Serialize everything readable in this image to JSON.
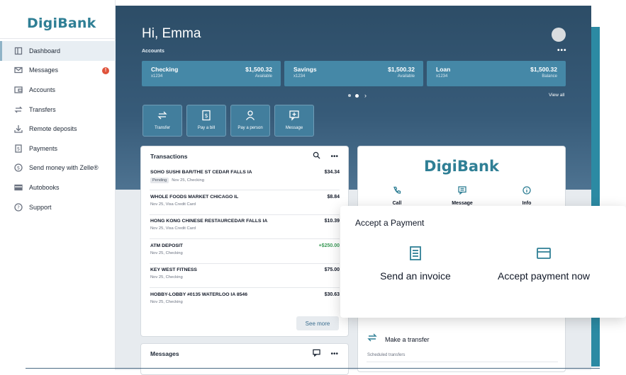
{
  "brand": {
    "name": "DigiBank",
    "color": "#2f7f95"
  },
  "sidebar": {
    "items": [
      {
        "label": "Dashboard",
        "icon": "dashboard-icon",
        "active": true
      },
      {
        "label": "Messages",
        "icon": "mail-icon",
        "badge": "!"
      },
      {
        "label": "Accounts",
        "icon": "wallet-icon"
      },
      {
        "label": "Transfers",
        "icon": "transfer-icon"
      },
      {
        "label": "Remote deposits",
        "icon": "download-icon"
      },
      {
        "label": "Payments",
        "icon": "dollar-doc-icon"
      },
      {
        "label": "Send money with Zelle®",
        "icon": "dollar-circle-icon"
      },
      {
        "label": "Autobooks",
        "icon": "card-icon"
      },
      {
        "label": "Support",
        "icon": "help-icon"
      }
    ]
  },
  "header": {
    "greeting": "Hi, Emma",
    "accounts_label": "Accounts",
    "more": "•••"
  },
  "accounts": [
    {
      "name": "Checking",
      "number": "x1234",
      "balance": "$1,500.32",
      "sub": "Available"
    },
    {
      "name": "Savings",
      "number": "x1234",
      "balance": "$1,500.32",
      "sub": "Available"
    },
    {
      "name": "Loan",
      "number": "x1234",
      "balance": "$1,500.32",
      "sub": "Balance"
    }
  ],
  "carousel": {
    "next": "›",
    "view_all": "View all"
  },
  "quick_actions": [
    {
      "label": "Transfer",
      "icon": "transfer-icon"
    },
    {
      "label": "Pay a bill",
      "icon": "bill-icon"
    },
    {
      "label": "Pay a person",
      "icon": "person-icon"
    },
    {
      "label": "Message",
      "icon": "message-icon"
    }
  ],
  "transactions": {
    "title": "Transactions",
    "more": "•••",
    "rows": [
      {
        "desc": "SOHO SUSHI BAR/THE ST CEDAR FALLS IA",
        "status": "Pending",
        "meta": "Nov 25, Checking",
        "amount": "$34.34"
      },
      {
        "desc": "WHOLE FOODS MARKET CHICAGO IL",
        "meta": "Nov 25, Visa Credit Card",
        "amount": "$8.84"
      },
      {
        "desc": "HONG KONG CHINESE RESTAURCEDAR FALLS IA",
        "meta": "Nov 25, Visa Credit Card",
        "amount": "$10.39"
      },
      {
        "desc": "ATM DEPOSIT",
        "meta": "Nov 25, Checking",
        "amount": "+$250.00",
        "positive": true
      },
      {
        "desc": "KEY WEST FITNESS",
        "meta": "Nov 25, Checking",
        "amount": "$75.00"
      },
      {
        "desc": "HOBBY-LOBBY #0135 WATERLOO IA 8546",
        "meta": "Nov 25, Checking",
        "amount": "$30.63"
      }
    ],
    "see_more": "See more"
  },
  "messages_card": {
    "title": "Messages",
    "more": "•••"
  },
  "promo": {
    "logo": "DigiBank",
    "actions": [
      {
        "label": "Call",
        "icon": "phone-icon"
      },
      {
        "label": "Message",
        "icon": "message-icon"
      },
      {
        "label": "Info",
        "icon": "info-icon"
      }
    ],
    "transfer_label": "Make a transfer",
    "scheduled_label": "Scheduled transfers"
  },
  "popover": {
    "title": "Accept a Payment",
    "options": [
      {
        "label": "Send an invoice",
        "icon": "invoice-icon"
      },
      {
        "label": "Accept payment now",
        "icon": "card-icon"
      }
    ]
  }
}
